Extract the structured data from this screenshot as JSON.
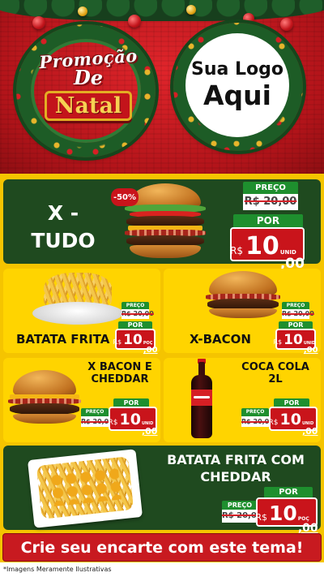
{
  "header": {
    "promo_line1": "Promoção",
    "promo_line2": "De",
    "promo_line3": "Natal",
    "logo_line1": "Sua Logo",
    "logo_line2": "Aqui"
  },
  "products": [
    {
      "name": "X -\nTUDO",
      "discount": "-50%",
      "price_label": "PREÇO",
      "old_price": "R$ 20,00",
      "por_label": "POR",
      "currency": "R$",
      "price_int": "10",
      "price_cents": ",00",
      "unit": "UNID"
    },
    {
      "name": "BATATA FRITA",
      "price_label": "PREÇO",
      "old_price": "R$ 20,00",
      "por_label": "POR",
      "currency": "R$",
      "price_int": "10",
      "price_cents": ",00",
      "unit": "POÇ"
    },
    {
      "name": "X-BACON",
      "price_label": "PREÇO",
      "old_price": "R$ 20,00",
      "por_label": "POR",
      "currency": "R$",
      "price_int": "10",
      "price_cents": ",00",
      "unit": "UNID"
    },
    {
      "name": "X BACON E\nCHEDDAR",
      "price_label": "PREÇO",
      "old_price": "R$ 20,00",
      "por_label": "POR",
      "currency": "R$",
      "price_int": "10",
      "price_cents": ",00",
      "unit": "UNID"
    },
    {
      "name": "COCA COLA\n2L",
      "price_label": "PREÇO",
      "old_price": "R$ 20,00",
      "por_label": "POR",
      "currency": "R$",
      "price_int": "10",
      "price_cents": ",00",
      "unit": "UNID"
    },
    {
      "name": "BATATA FRITA COM\nCHEDDAR",
      "price_label": "PREÇO",
      "old_price": "R$ 20,00",
      "por_label": "POR",
      "currency": "R$",
      "price_int": "10",
      "price_cents": ",00",
      "unit": "POÇ"
    }
  ],
  "cta": "Crie seu encarte com este tema!",
  "footer_note": "*Imagens Meramente Ilustrativas",
  "colors": {
    "red": "#c9141b",
    "green_dark": "#1f4a1f",
    "green_label": "#1e8f2e",
    "yellow": "#ffd400"
  }
}
